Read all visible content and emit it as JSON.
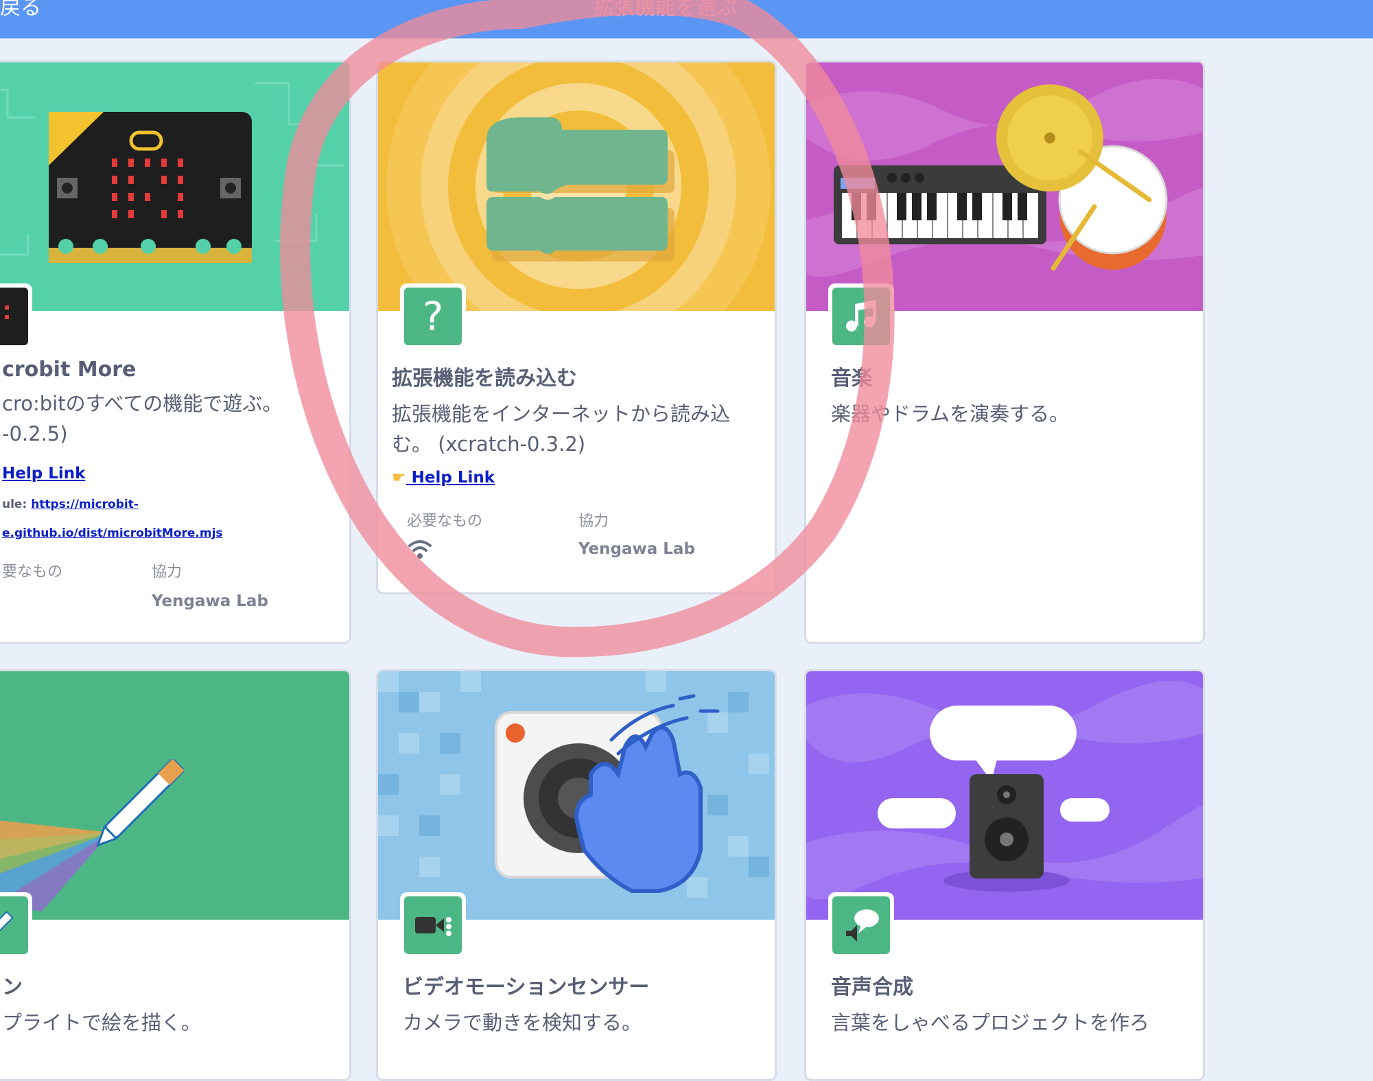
{
  "header": {
    "back_label": "戻る",
    "title": "拡張機能を選ぶ"
  },
  "cards": {
    "microbit": {
      "title": "crobit More",
      "desc_line1": "cro:bitのすべての機能で遊ぶ。",
      "desc_line2": "-0.2.5)",
      "help_link": "Help Link",
      "module_label": "ule:",
      "module_url_1": "https://microbit-",
      "module_url_2": "e.github.io/dist/microbitMore.mjs",
      "requires_label": "要なもの",
      "collab_label": "協力",
      "collab_value": "Yengawa Lab"
    },
    "load": {
      "title": "拡張機能を読み込む",
      "desc_line1": "拡張機能をインターネットから読み込",
      "desc_line2": "む。 (xcratch-0.3.2)",
      "help_link": "Help Link",
      "requires_label": "必要なもの",
      "collab_label": "協力",
      "collab_value": "Yengawa Lab",
      "icon_char": "?"
    },
    "music": {
      "title": "音楽",
      "desc": "楽器やドラムを演奏する。"
    },
    "pen": {
      "title": "ン",
      "desc": "プライトで絵を描く。"
    },
    "video": {
      "title": "ビデオモーションセンサー",
      "desc": "カメラで動きを検知する。"
    },
    "tts": {
      "title": "音声合成",
      "desc": "言葉をしゃべるプロジェクトを作ろ"
    }
  },
  "colors": {
    "header": "#5b96f5",
    "icon_bg": "#4cb784",
    "annotation": "#f08a9a"
  }
}
